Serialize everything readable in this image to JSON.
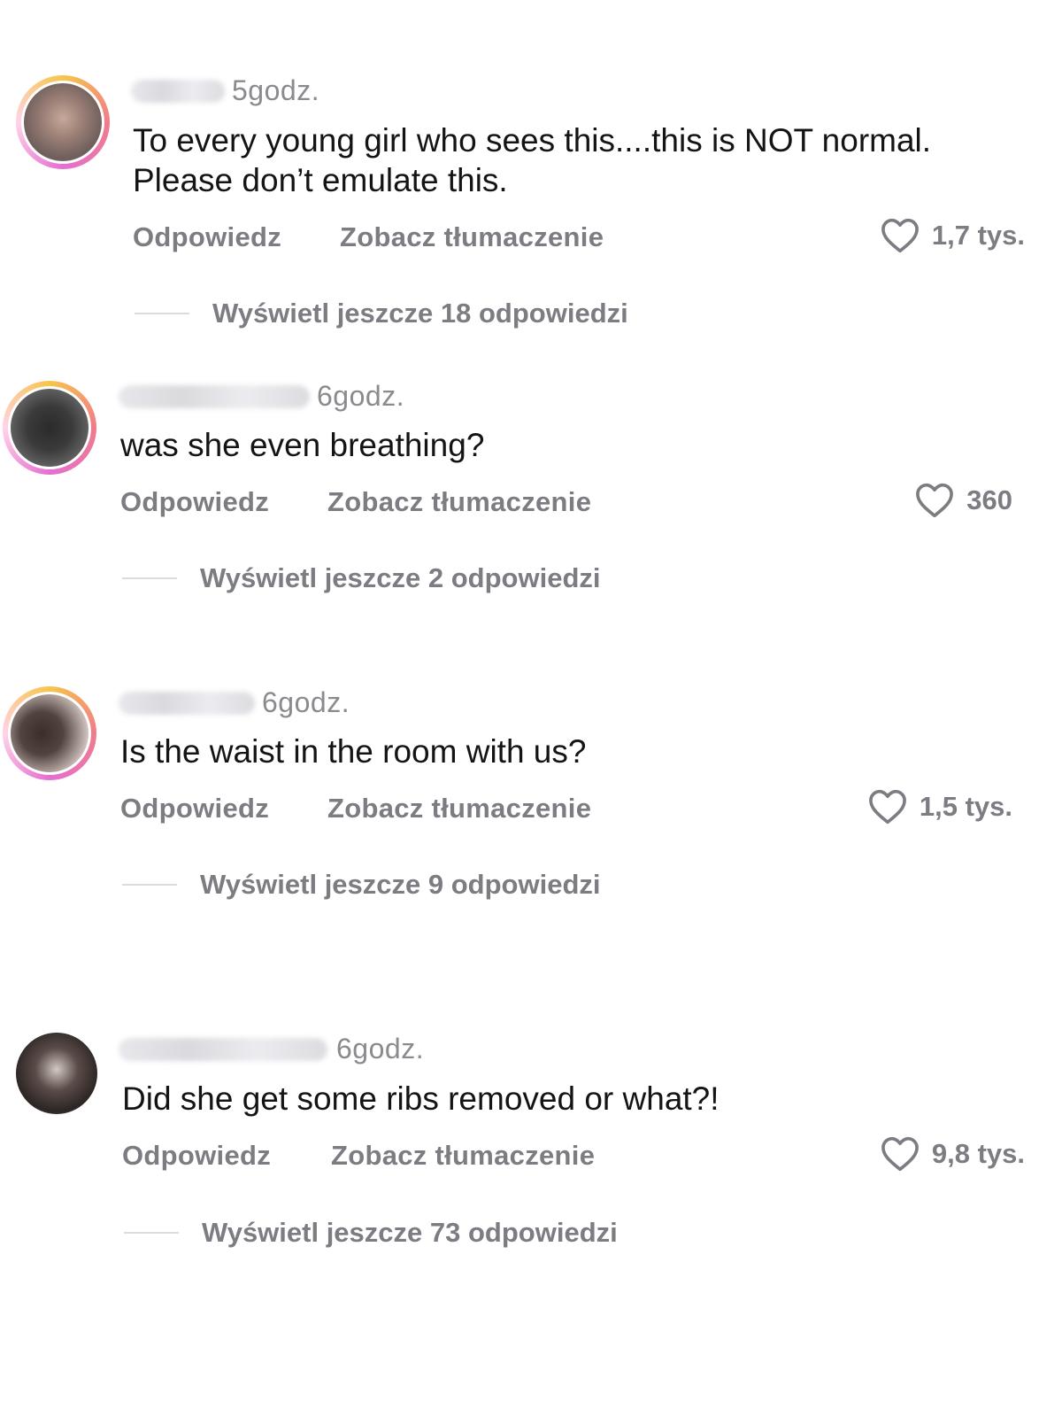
{
  "comments": [
    {
      "time": "5godz.",
      "text": "To every young girl who sees this....this is NOT normal.\nPlease don’t emulate this.",
      "reply_label": "Odpowiedz",
      "translate_label": "Zobacz tłumaczenie",
      "likes": "1,7 tys.",
      "more_replies": "Wyświetl jeszcze 18 odpowiedzi"
    },
    {
      "time": "6godz.",
      "text": "was she even breathing?",
      "reply_label": "Odpowiedz",
      "translate_label": "Zobacz tłumaczenie",
      "likes": "360",
      "more_replies": "Wyświetl jeszcze 2 odpowiedzi"
    },
    {
      "time": "6godz.",
      "text": "Is the waist in the room with us?",
      "reply_label": "Odpowiedz",
      "translate_label": "Zobacz tłumaczenie",
      "likes": "1,5 tys.",
      "more_replies": "Wyświetl jeszcze 9 odpowiedzi"
    },
    {
      "time": "6godz.",
      "text": "Did she get some ribs removed or what?!",
      "reply_label": "Odpowiedz",
      "translate_label": "Zobacz tłumaczenie",
      "likes": "9,8 tys.",
      "more_replies": "Wyświetl jeszcze 73 odpowiedzi"
    }
  ],
  "icons": {
    "like": "heart-outline-icon",
    "avatar_ring_colors": [
      "#f7c54a",
      "#f07b8a",
      "#e56fd0"
    ]
  },
  "colors": {
    "text": "#141414",
    "secondary": "#7c7c82",
    "background": "#ffffff"
  }
}
